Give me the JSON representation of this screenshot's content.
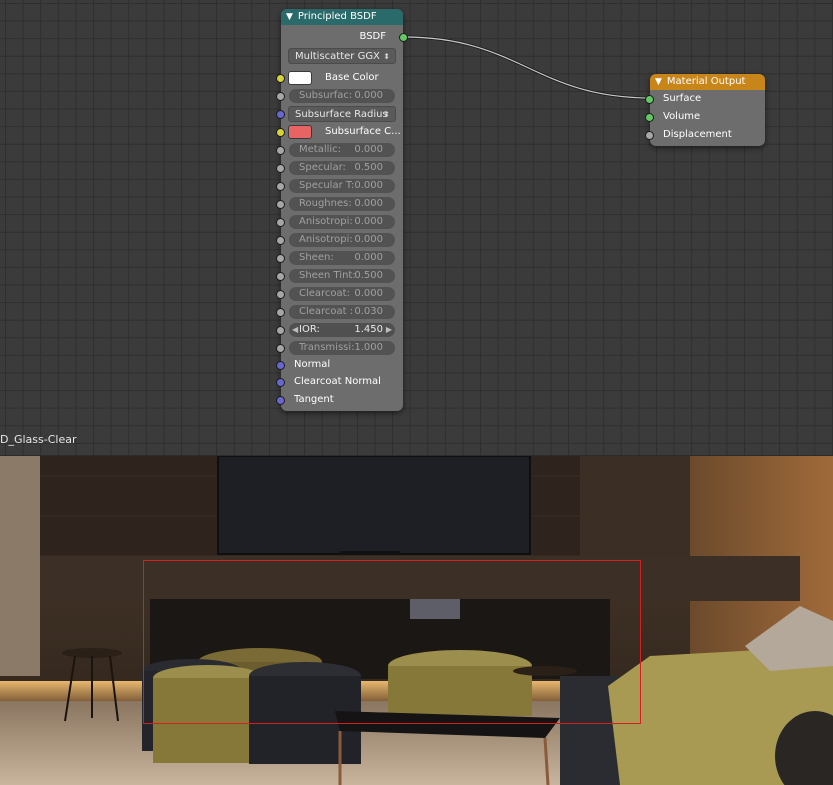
{
  "bsdf_node": {
    "title": "Principled BSDF",
    "output_label": "BSDF",
    "distribution": "Multiscatter GGX",
    "base_color_label": "Base Color",
    "base_color": "#ffffff",
    "subsurface_radius_label": "Subsurface Radius",
    "subsurface_color_label": "Subsurface C...",
    "subsurface_color": "#e86464",
    "params": [
      {
        "label": "Subsurfac:",
        "value": "0.000"
      },
      {
        "label": "Metallic:",
        "value": "0.000"
      },
      {
        "label": "Specular:",
        "value": "0.500"
      },
      {
        "label": "Specular T:",
        "value": "0.000"
      },
      {
        "label": "Roughnes:",
        "value": "0.000"
      },
      {
        "label": "Anisotropi:",
        "value": "0.000"
      },
      {
        "label": "Anisotropi:",
        "value": "0.000"
      },
      {
        "label": "Sheen:",
        "value": "0.000"
      },
      {
        "label": "Sheen Tint:",
        "value": "0.500"
      },
      {
        "label": "Clearcoat:",
        "value": "0.000"
      },
      {
        "label": "Clearcoat :",
        "value": "0.030"
      },
      {
        "label": "IOR:",
        "value": "1.450"
      },
      {
        "label": "Transmissi:",
        "value": "1.000"
      }
    ],
    "vector_inputs": [
      "Normal",
      "Clearcoat Normal",
      "Tangent"
    ]
  },
  "output_node": {
    "title": "Material Output",
    "inputs": [
      "Surface",
      "Volume",
      "Displacement"
    ]
  },
  "material_name": "D_Glass-Clear",
  "colors": {
    "shader_socket": "#63c763",
    "color_socket": "#d8d23a",
    "value_socket": "#a6a6a6",
    "vector_socket": "#6667d1",
    "bsdf_header": "#2b6a6a",
    "output_header": "#c8851a",
    "selection_box": "#d42020"
  }
}
